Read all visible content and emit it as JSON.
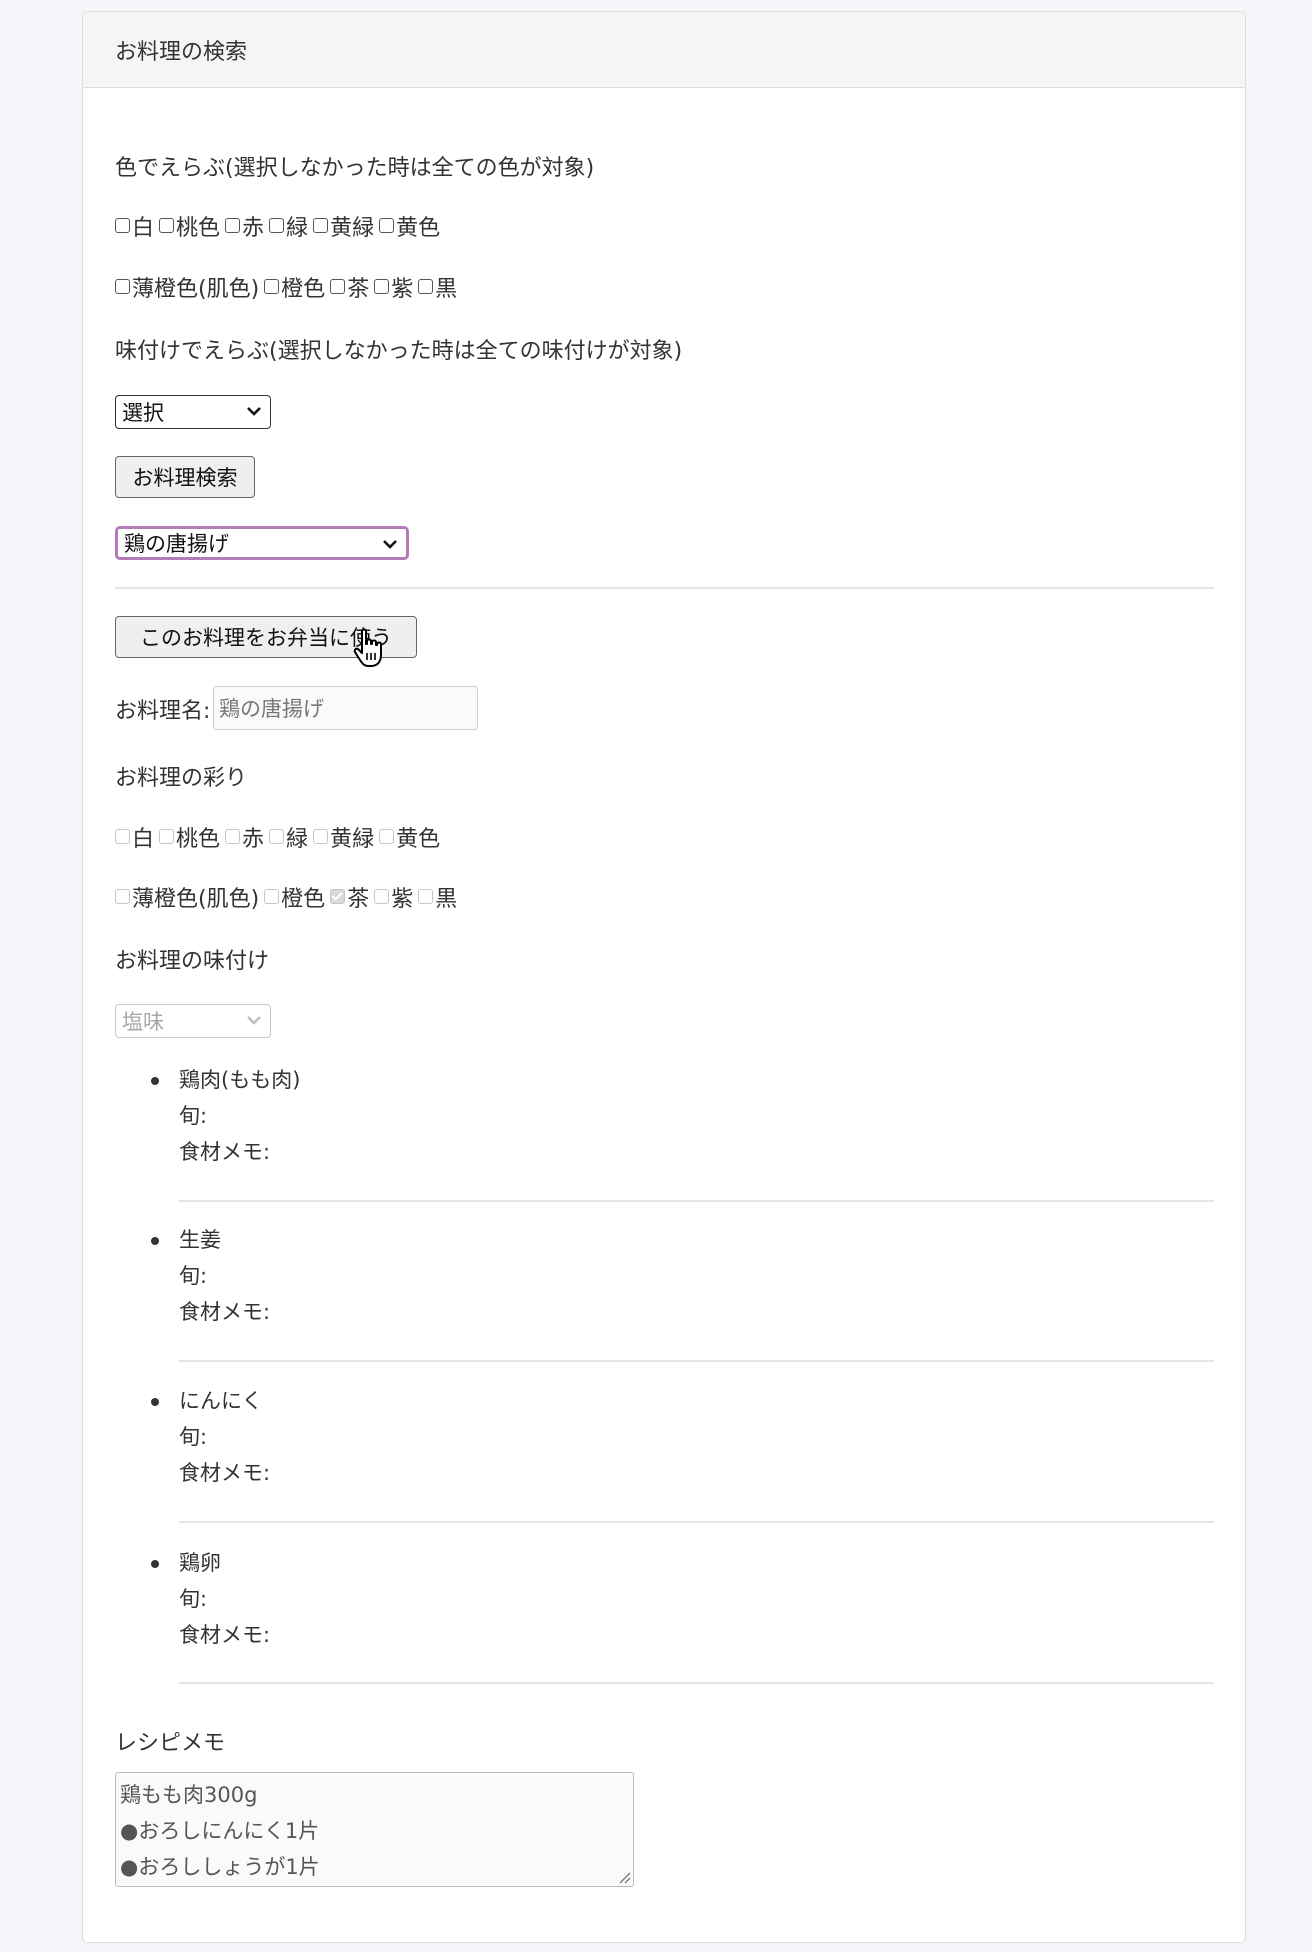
{
  "header": {
    "title": "お料理の検索"
  },
  "search": {
    "color_heading": "色でえらぶ(選択しなかった時は全ての色が対象)",
    "colors_row1": [
      "白",
      "桃色",
      "赤",
      "緑",
      "黄緑",
      "黄色"
    ],
    "colors_row2": [
      "薄橙色(肌色)",
      "橙色",
      "茶",
      "紫",
      "黒"
    ],
    "taste_heading": "味付けでえらぶ(選択しなかった時は全ての味付けが対象)",
    "taste_select_value": "選択",
    "search_button": "お料理検索",
    "dish_select_value": "鶏の唐揚げ"
  },
  "detail": {
    "use_button": "このお料理をお弁当に使う",
    "name_label": "お料理名:",
    "name_value": "鶏の唐揚げ",
    "color_heading": "お料理の彩り",
    "colors_row1": [
      "白",
      "桃色",
      "赤",
      "緑",
      "黄緑",
      "黄色"
    ],
    "colors_row2": [
      "薄橙色(肌色)",
      "橙色",
      "茶",
      "紫",
      "黒"
    ],
    "checked_color": "茶",
    "taste_heading": "お料理の味付け",
    "taste_value": "塩味",
    "ingredients": [
      {
        "name": "鶏肉(もも肉)",
        "season_label": "旬:",
        "memo_label": "食材メモ:"
      },
      {
        "name": "生姜",
        "season_label": "旬:",
        "memo_label": "食材メモ:"
      },
      {
        "name": "にんにく",
        "season_label": "旬:",
        "memo_label": "食材メモ:"
      },
      {
        "name": "鶏卵",
        "season_label": "旬:",
        "memo_label": "食材メモ:"
      }
    ],
    "recipe_heading": "レシピメモ",
    "recipe_lines": [
      "鶏もも肉300g",
      "●おろしにんにく1片",
      "●おろししょうが1片"
    ]
  }
}
